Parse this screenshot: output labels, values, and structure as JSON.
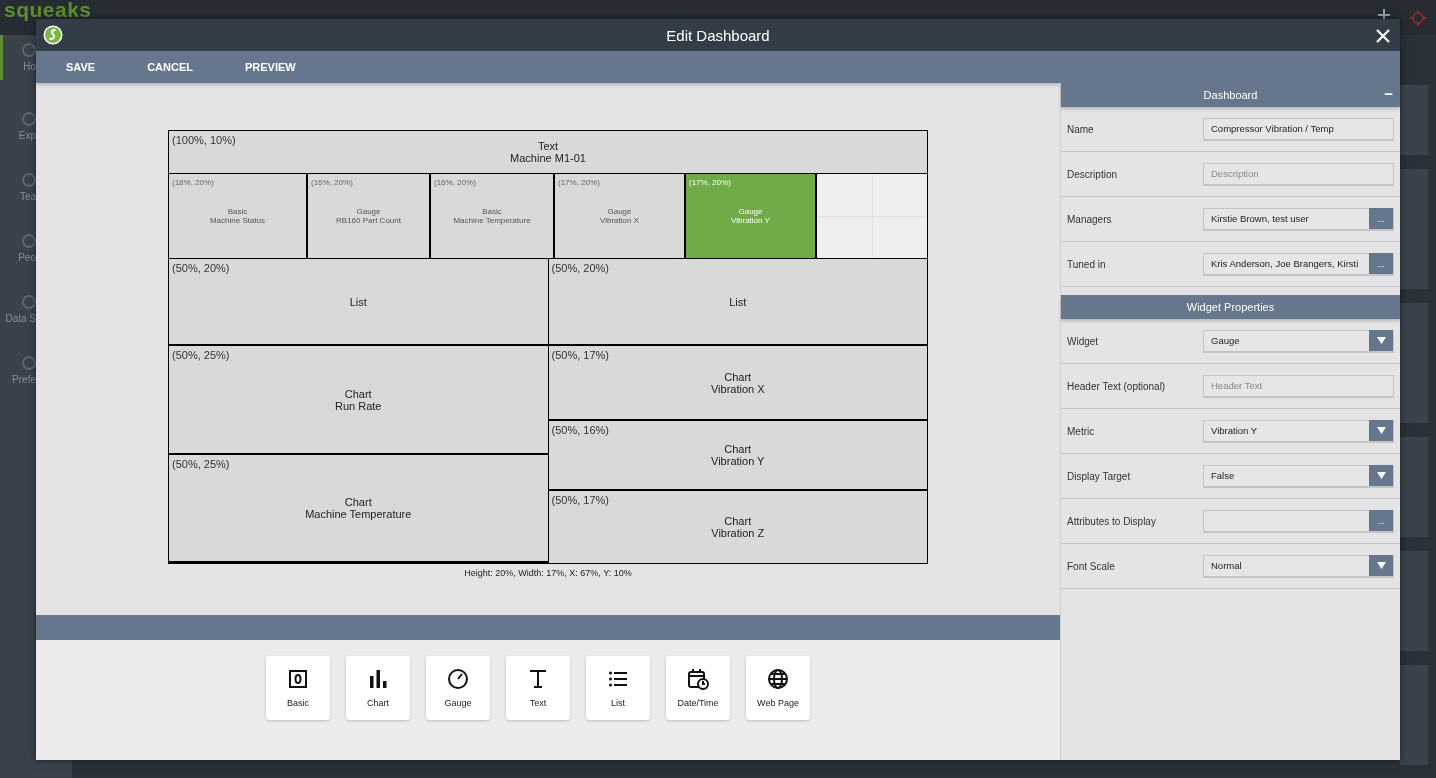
{
  "app": {
    "logo": "squeaks",
    "nav": [
      {
        "label": "Ho",
        "selected": true
      },
      {
        "label": "Exp",
        "selected": false
      },
      {
        "label": "Tea",
        "selected": false
      },
      {
        "label": "Peo",
        "selected": false
      },
      {
        "label": "Data S",
        "selected": false
      },
      {
        "label": "Prefe",
        "selected": false
      }
    ]
  },
  "modal": {
    "title": "Edit Dashboard",
    "toolbar": [
      "SAVE",
      "CANCEL",
      "PREVIEW"
    ]
  },
  "layout": {
    "header": {
      "size": "(100%, 10%)",
      "type": "Text",
      "name": "Machine M1-01",
      "selected": false
    },
    "row": [
      {
        "size": "(18%, 20%)",
        "type": "Basic",
        "name": "Machine Status",
        "selected": false
      },
      {
        "size": "(16%, 20%)",
        "type": "Gauge",
        "name": "RB160 Part Count",
        "selected": false
      },
      {
        "size": "(16%, 20%)",
        "type": "Basic",
        "name": "Machine Temperature",
        "selected": false
      },
      {
        "size": "(17%, 20%)",
        "type": "Gauge",
        "name": "Vibration X",
        "selected": false
      },
      {
        "size": "(17%, 20%)",
        "type": "Gauge",
        "name": "Vibration Y",
        "selected": true
      }
    ],
    "left_column": [
      {
        "size": "(50%, 20%)",
        "type": "List",
        "selected": false
      },
      {
        "size": "(50%, 25%)",
        "type": "Chart",
        "name": "Run Rate",
        "selected": false
      },
      {
        "size": "(50%, 25%)",
        "type": "Chart",
        "name": "Machine Temperature",
        "selected": false
      }
    ],
    "right_column": [
      {
        "size": "(50%, 20%)",
        "type": "List",
        "selected": false
      },
      {
        "size": "(50%, 17%)",
        "type": "Chart",
        "name": "Vibration X",
        "selected": false
      },
      {
        "size": "(50%, 16%)",
        "type": "Chart",
        "name": "Vibration Y",
        "selected": false
      },
      {
        "size": "(50%, 17%)",
        "type": "Chart",
        "name": "Vibration Z",
        "selected": false
      }
    ],
    "caption": "Height: 20%, Width: 17%, X: 67%, Y: 10%"
  },
  "palette": [
    {
      "label": "Basic",
      "kind": "basic"
    },
    {
      "label": "Chart",
      "kind": "chart"
    },
    {
      "label": "Gauge",
      "kind": "gauge"
    },
    {
      "label": "Text",
      "kind": "text"
    },
    {
      "label": "List",
      "kind": "list"
    },
    {
      "label": "Date/Time",
      "kind": "datetime"
    },
    {
      "label": "Web Page",
      "kind": "web"
    }
  ],
  "panel": [
    {
      "title": "Dashboard",
      "collapse": "−",
      "fields": [
        {
          "label": "Name",
          "kind": "text",
          "value": "Compressor Vibration /  Temp"
        },
        {
          "label": "Description",
          "kind": "text",
          "placeholder": "Description"
        },
        {
          "label": "Managers",
          "kind": "picker",
          "value": "Kirstie Brown, test user",
          "button": "..."
        },
        {
          "label": "Tuned in",
          "kind": "picker",
          "value": "Kris Anderson, Joe Brangers, Kirsti",
          "button": "..."
        }
      ]
    },
    {
      "title": "Widget Properties",
      "fields": [
        {
          "label": "Widget",
          "kind": "select",
          "value": "Gauge"
        },
        {
          "label": "Header Text (optional)",
          "kind": "text",
          "placeholder": "Header Text"
        },
        {
          "label": "Metric",
          "kind": "select",
          "value": "Vibration Y"
        },
        {
          "label": "Display Target",
          "kind": "select",
          "value": "False"
        },
        {
          "label": "Attributes to Display",
          "kind": "picker",
          "button": "..."
        },
        {
          "label": "Font Scale",
          "kind": "select",
          "value": "Normal"
        }
      ]
    }
  ]
}
